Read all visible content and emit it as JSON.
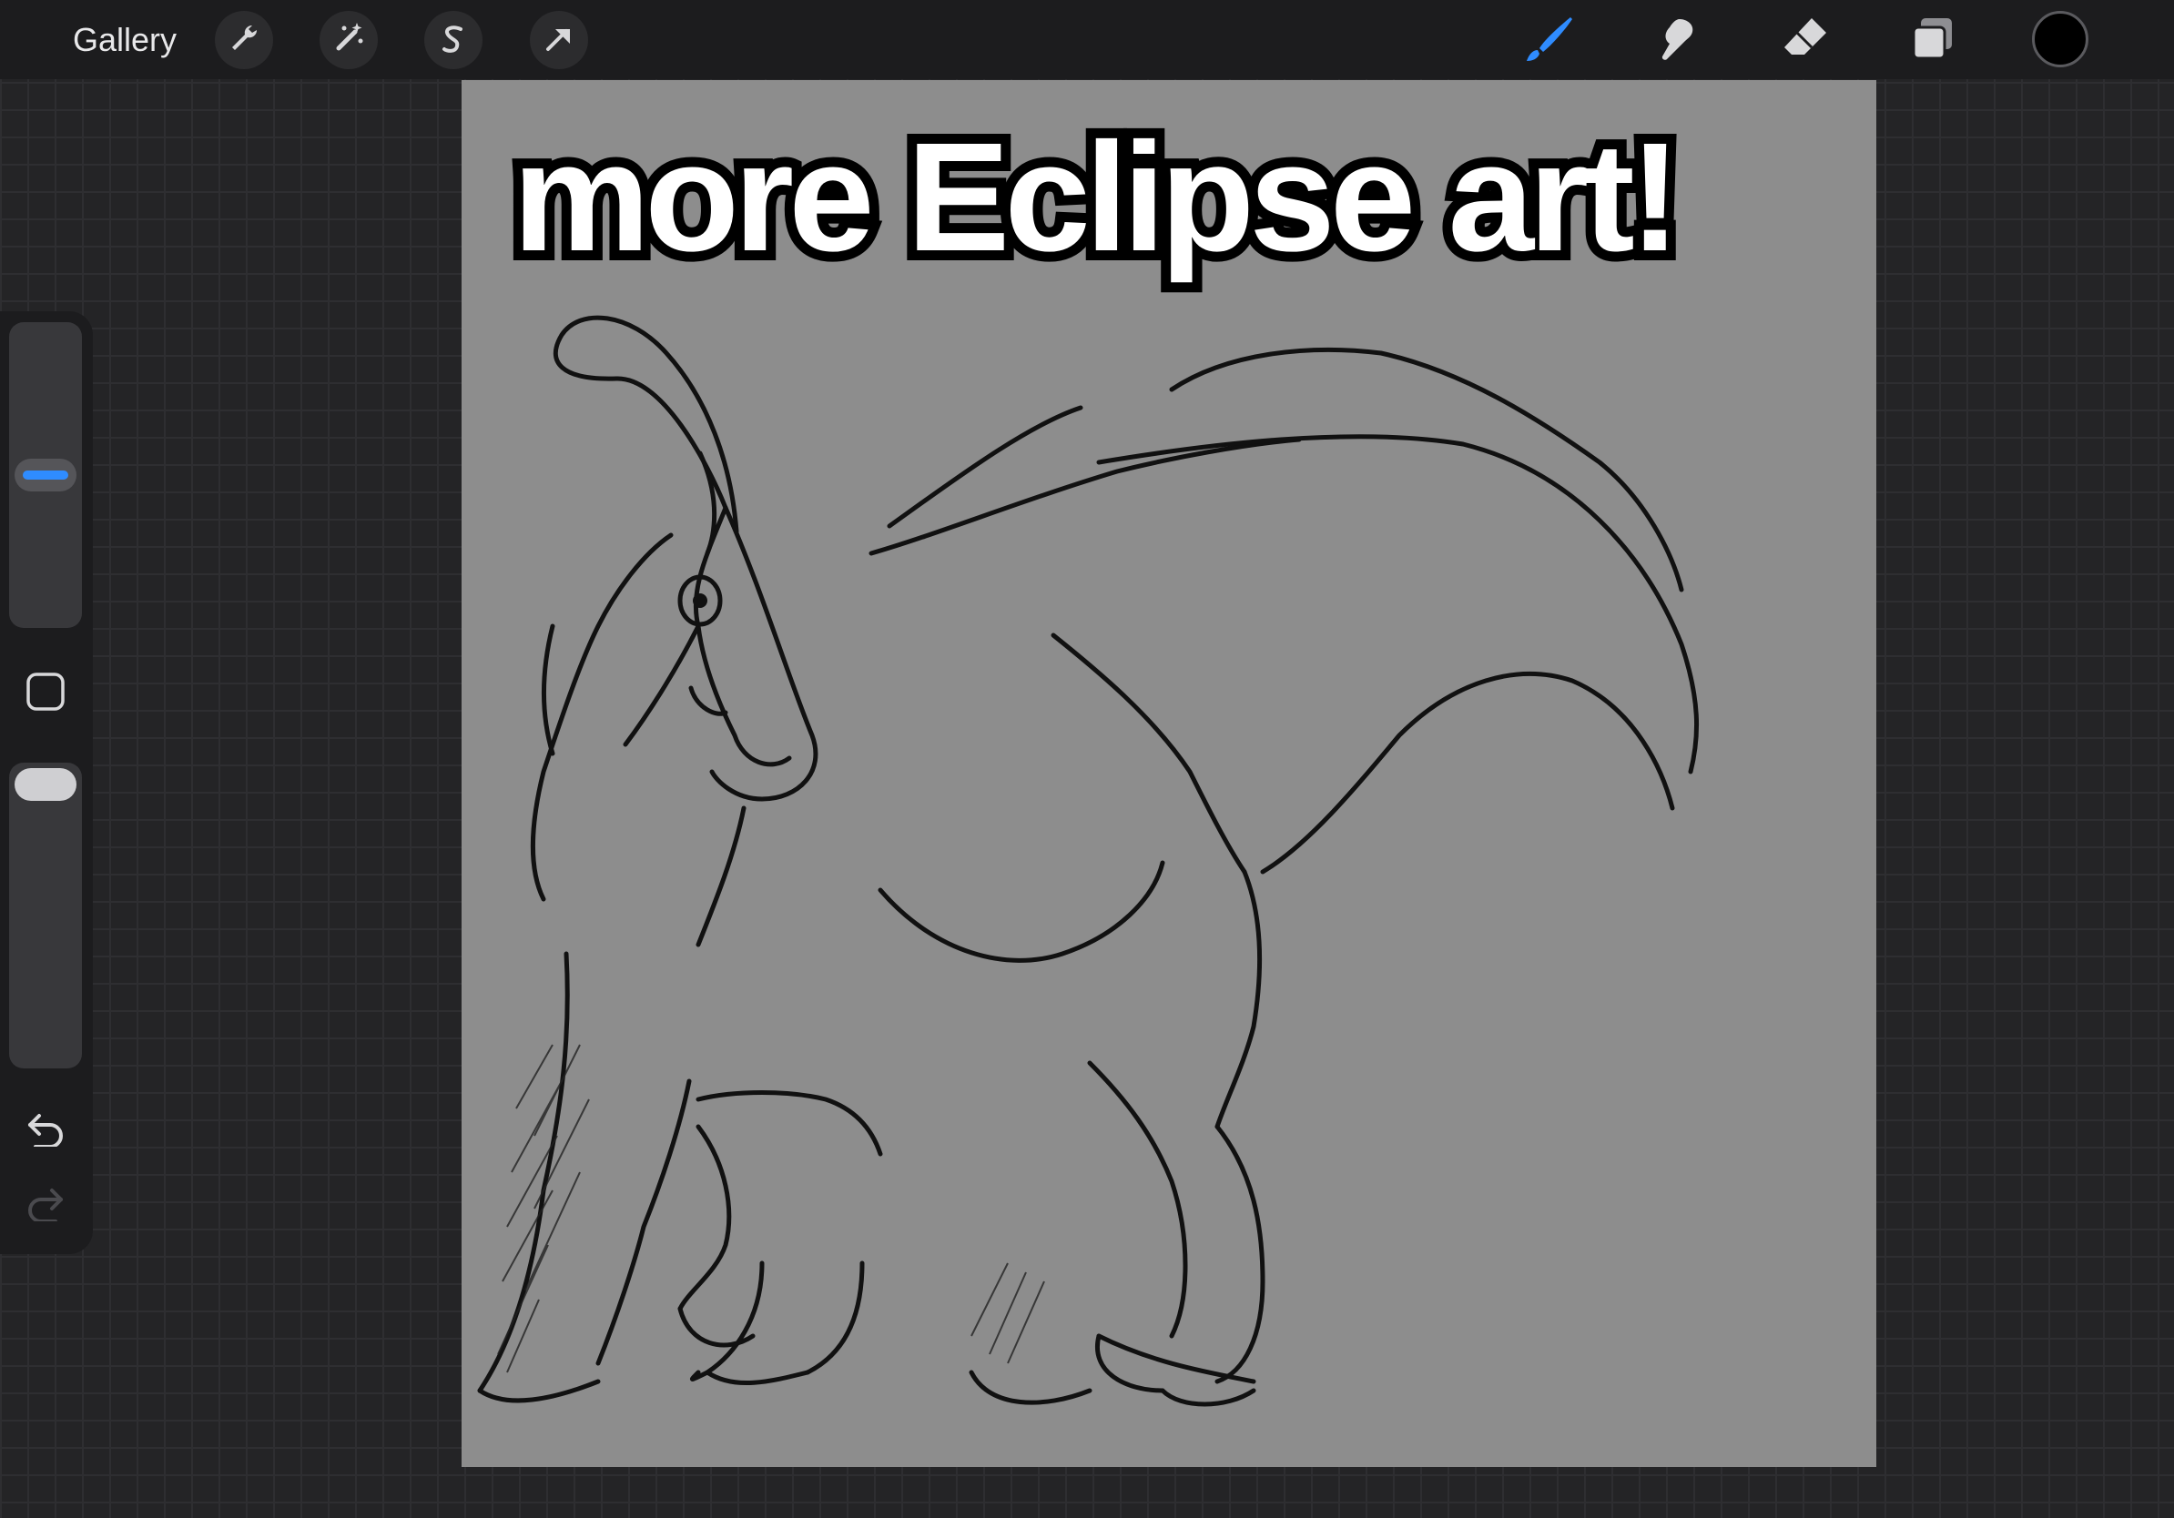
{
  "topbar": {
    "gallery_label": "Gallery",
    "left_tools": [
      {
        "name": "wrench-icon",
        "label": "Actions"
      },
      {
        "name": "magic-wand-icon",
        "label": "Adjustments"
      },
      {
        "name": "selection-icon",
        "label": "Selection"
      },
      {
        "name": "transform-arrow-icon",
        "label": "Transform"
      }
    ],
    "right_tools": [
      {
        "name": "brush-icon",
        "active": true
      },
      {
        "name": "smudge-icon",
        "active": false
      },
      {
        "name": "eraser-icon",
        "active": false
      },
      {
        "name": "layers-icon",
        "active": false
      }
    ],
    "current_color": "#000000"
  },
  "sidebar": {
    "brush_size_level": 0.5,
    "opacity_level": 1.0,
    "icons": [
      "modify-square-icon",
      "undo-icon",
      "redo-icon"
    ]
  },
  "canvas": {
    "caption": "more Eclipse art!",
    "background": "#8d8d8d",
    "artwork": "line sketch of a crested dinosaur"
  },
  "colors": {
    "accent": "#2f8cff",
    "toolbar_bg": "#1c1c1e",
    "workspace_bg": "#242426"
  }
}
